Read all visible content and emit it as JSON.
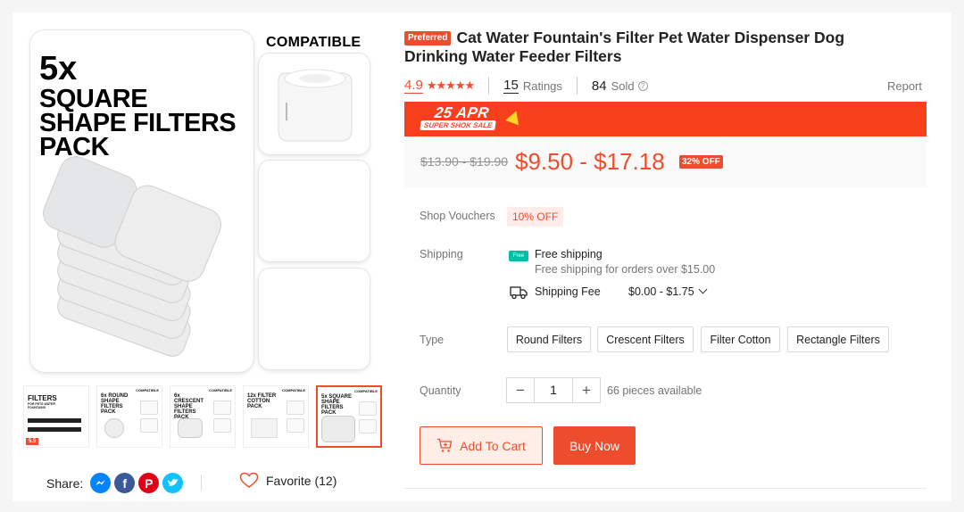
{
  "gallery": {
    "pack_count": "5x",
    "pack_lines": [
      "SQUARE",
      "SHAPE FILTERS",
      "PACK"
    ],
    "compatible_title": "COMPATIBLE",
    "thumbnails": [
      {
        "title": "FILTERS",
        "sub": "FOR PETS WATER FOUNTAINS",
        "tag": "5.5"
      },
      {
        "title": "6x ROUND SHAPE FILTERS PACK",
        "tag": "COMPATIBLE"
      },
      {
        "title": "6x CRESCENT SHAPE FILTERS PACK",
        "tag": "COMPATIBLE"
      },
      {
        "title": "12x FILTER COTTON PACK",
        "tag": "COMPATIBLE"
      },
      {
        "title": "5x SQUARE SHAPE FILTERS PACK",
        "tag": "COMPATIBLE"
      }
    ]
  },
  "share": {
    "label": "Share:"
  },
  "favorite": {
    "label": "Favorite (12)"
  },
  "product": {
    "preferred_badge": "Preferred",
    "title": "Cat Water Fountain's Filter Pet Water Dispenser Dog Drinking Water Feeder Filters",
    "rating": "4.9",
    "ratings_count": "15",
    "ratings_label": "Ratings",
    "sold_count": "84",
    "sold_label": "Sold",
    "report_label": "Report"
  },
  "flash_sale": {
    "date": "25 APR",
    "subtitle": "SUPER SHOK SALE"
  },
  "price": {
    "original": "$13.90 - $19.90",
    "current": "$9.50 - $17.18",
    "discount": "32% OFF"
  },
  "vouchers": {
    "label": "Shop Vouchers",
    "value": "10% OFF"
  },
  "shipping": {
    "label": "Shipping",
    "free_icon_text": "Free",
    "free_title": "Free shipping",
    "free_sub": "Free shipping for orders over $15.00",
    "fee_label": "Shipping Fee",
    "fee_value": "$0.00 - $1.75"
  },
  "type": {
    "label": "Type",
    "options": [
      "Round Filters",
      "Crescent Filters",
      "Filter Cotton",
      "Rectangle Filters"
    ]
  },
  "quantity": {
    "label": "Quantity",
    "minus": "−",
    "value": "1",
    "plus": "+",
    "available": "66 pieces available"
  },
  "actions": {
    "add_to_cart": "Add To Cart",
    "buy_now": "Buy Now"
  },
  "colors": {
    "accent": "#ee4d2d",
    "flash_bg": "#f7401b",
    "free_ship": "#00bfa5"
  }
}
